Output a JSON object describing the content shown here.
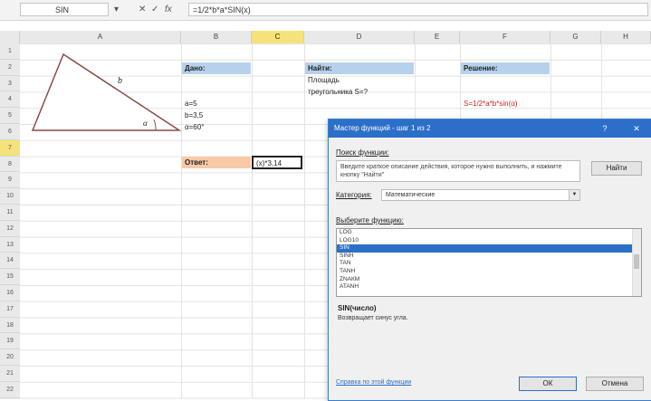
{
  "formula_bar": {
    "name_box": "SIN",
    "cancel_icon": "✕",
    "enter_icon": "✓",
    "fx_label": "fx",
    "formula": "=1/2*b*a*SIN(х)"
  },
  "columns": [
    "A",
    "B",
    "C",
    "D",
    "E",
    "F",
    "G",
    "H"
  ],
  "active_column": "C",
  "rows": [
    "1",
    "2",
    "3",
    "4",
    "5",
    "6",
    "7",
    "8",
    "9",
    "10",
    "11",
    "12",
    "13",
    "14",
    "15",
    "16",
    "17",
    "18",
    "19",
    "20",
    "21",
    "22"
  ],
  "active_row": "7",
  "triangle": {
    "label_b": "b",
    "label_a": "a",
    "label_alpha": "α"
  },
  "cells": {
    "given_header": "Дано:",
    "a_value": "a=5",
    "b_value": "b=3,5",
    "alpha_value": "α=60°",
    "answer_label": "Ответ:",
    "active_cell": "(х)*3,14",
    "find_header": "Найти:",
    "find_line1": "Площадь",
    "find_line2": "треугольника S=?",
    "solution_header": "Решение:",
    "solution_formula": "S=1/2*a*b*sin(α)"
  },
  "dialog": {
    "title": "Мастер функций - шаг 1 из 2",
    "help_icon": "?",
    "close_icon": "✕",
    "search_label": "Поиск функции:",
    "search_text": "Введите краткое описание действия, которое нужно выполнить, и нажмите кнопку \"Найти\"",
    "find_button": "Найти",
    "category_label": "Категория:",
    "category_value": "Математические",
    "list_label": "Выберите функцию:",
    "functions": [
      "LOG",
      "LOG10",
      "SIN",
      "SINH",
      "TAN",
      "TANH",
      "ZNАКМ",
      "ATANH"
    ],
    "selected_function": "SIN",
    "function_signature": "SIN(число)",
    "function_description": "Возвращает синус угла.",
    "help_link": "Справка по этой функции",
    "ok_button": "ОК",
    "cancel_button": "Отмена"
  }
}
